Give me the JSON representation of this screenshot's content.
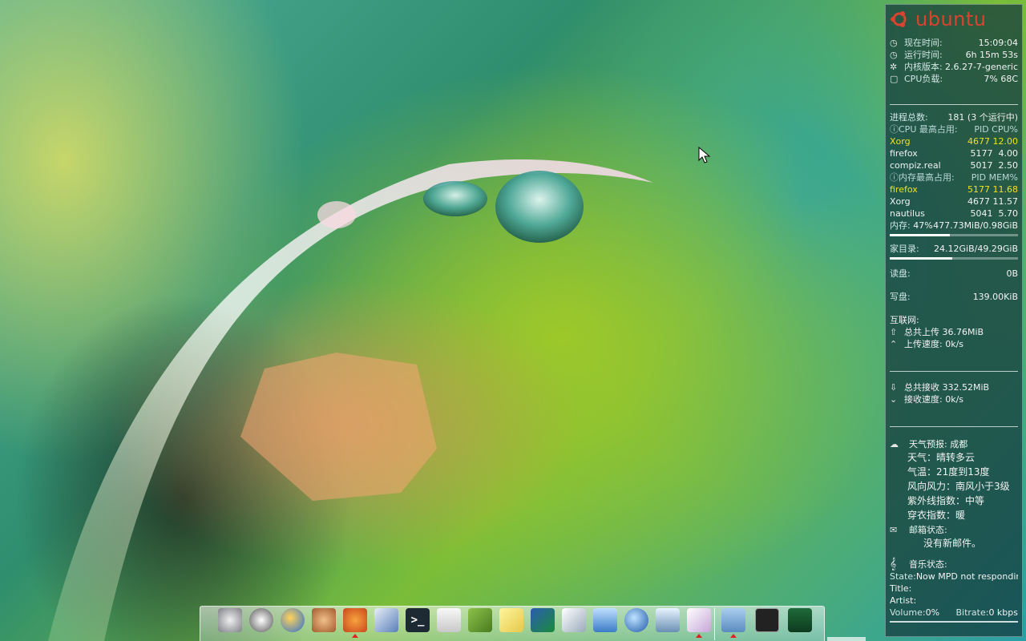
{
  "conky": {
    "logo_text": "ubuntu",
    "system": {
      "time_label": "现在时间:",
      "time_value": "15:09:04",
      "uptime_label": "运行时间:",
      "uptime_value": "6h 15m 53s",
      "kernel_label": "内核版本:",
      "kernel_value": "2.6.27-7-generic",
      "cpu_label": "CPU负载:",
      "cpu_value": "7% 68C"
    },
    "processes": {
      "total_label": "进程总数:",
      "total_value": "181  (3 个运行中)",
      "cpu_top_label": "CPU 最高占用:",
      "cpu_top_cols": "PID  CPU%",
      "cpu_top": [
        {
          "name": "Xorg",
          "pid": "4677",
          "val": "12.00"
        },
        {
          "name": "firefox",
          "pid": "5177",
          "val": "4.00"
        },
        {
          "name": "compiz.real",
          "pid": "5017",
          "val": "2.50"
        }
      ],
      "mem_top_label": "内存最高占用:",
      "mem_top_cols": "PID  MEM%",
      "mem_top": [
        {
          "name": "firefox",
          "pid": "5177",
          "val": "11.68"
        },
        {
          "name": "Xorg",
          "pid": "4677",
          "val": "11.57"
        },
        {
          "name": "nautilus",
          "pid": "5041",
          "val": "5.70"
        }
      ],
      "mem_label": "内存:",
      "mem_percent": "47%",
      "mem_value": "477.73MiB/0.98GiB",
      "mem_fraction": 0.47
    },
    "disk": {
      "home_label": "家目录:",
      "home_value": "24.12GiB/49.29GiB",
      "home_fraction": 0.49,
      "read_label": "读盘:",
      "read_value": "0B",
      "write_label": "写盘:",
      "write_value": "139.00KiB"
    },
    "net": {
      "heading": "互联网:",
      "up_total": "总共上传 36.76MiB",
      "up_speed": "上传速度: 0k/s",
      "down_total": "总共接收 332.52MiB",
      "down_speed": "接收速度: 0k/s"
    },
    "weather": {
      "label": "天气预报:",
      "city": "成都",
      "lines": [
        "天气：晴转多云",
        "气温：21度到13度",
        "风向风力：南风小于3级",
        "紫外线指数：中等",
        "穿衣指数：暖"
      ]
    },
    "mail": {
      "label": "邮箱状态:",
      "status": "没有新邮件。"
    },
    "music": {
      "label": "音乐状态:",
      "state_label": "State:",
      "state_value": "Now MPD not respondin",
      "title_label": "Title:",
      "artist_label": "Artist:",
      "volume_label": "Volume:",
      "volume_value": "0%",
      "bitrate_label": "Bitrate:",
      "bitrate_value": "0 kbps"
    }
  },
  "dock": {
    "icons": [
      "movie-player-icon",
      "headphones-icon",
      "ball-icon",
      "rabbit-icon",
      "fox-icon",
      "photo-icon",
      "terminal-icon",
      "calculator-icon",
      "book-icon",
      "notes-icon",
      "mathematics-icon",
      "chart-icon",
      "presentation-icon",
      "globe-icon",
      "computer-icon",
      "package-icon",
      "folder-icon",
      "terminal-window-icon",
      "system-monitor-icon"
    ]
  },
  "colors": {
    "accent_red": "#d9432f",
    "highlight_yellow": "#f0e020",
    "panel_bg": "#12373c"
  }
}
